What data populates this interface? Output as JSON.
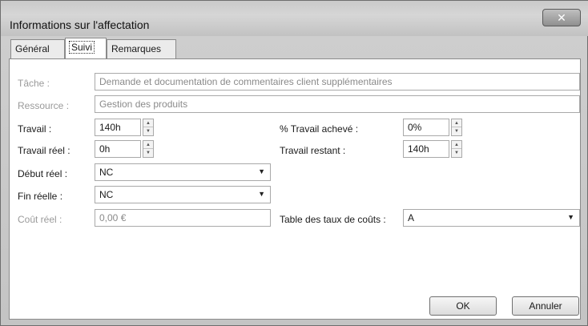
{
  "window": {
    "title": "Informations sur l'affectation",
    "close_glyph": "✕"
  },
  "tabs": [
    {
      "label": "Général"
    },
    {
      "label": "Suivi",
      "active": true
    },
    {
      "label": "Remarques"
    }
  ],
  "form": {
    "tache": {
      "label": "Tâche :",
      "value": "Demande et documentation de commentaires client supplémentaires"
    },
    "ressource": {
      "label": "Ressource :",
      "value": "Gestion des produits"
    },
    "travail": {
      "label": "Travail :",
      "value": "140h"
    },
    "travail_reel": {
      "label": "Travail réel :",
      "value": "0h"
    },
    "pct_travail_acheve": {
      "label": "% Travail achevé :",
      "value": "0%"
    },
    "travail_restant": {
      "label": "Travail restant :",
      "value": "140h"
    },
    "debut_reel": {
      "label": "Début réel :",
      "value": "NC"
    },
    "fin_reelle": {
      "label": "Fin réelle :",
      "value": "NC"
    },
    "cout_reel": {
      "label": "Coût réel :",
      "value": "0,00 €"
    },
    "table_taux": {
      "label": "Table des taux de coûts :",
      "value": "A"
    }
  },
  "buttons": {
    "ok": "OK",
    "annuler": "Annuler"
  }
}
